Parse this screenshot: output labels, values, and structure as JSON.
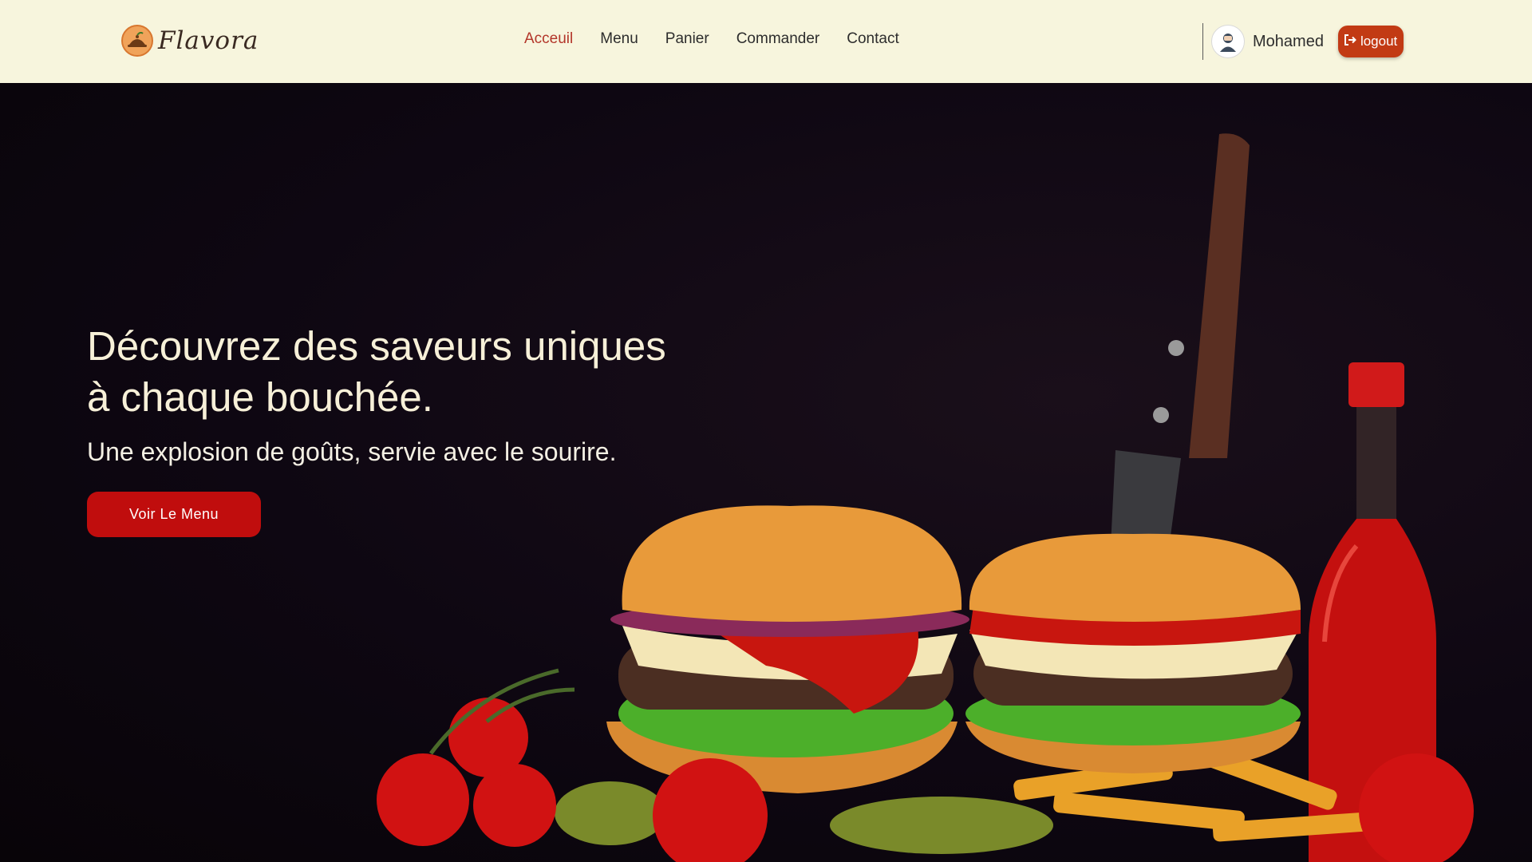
{
  "brand": {
    "name": "Flavora",
    "logo_icon": "cloche-icon"
  },
  "nav": {
    "links": [
      {
        "label": "Acceuil",
        "active": true
      },
      {
        "label": "Menu",
        "active": false
      },
      {
        "label": "Panier",
        "active": false
      },
      {
        "label": "Commander",
        "active": false
      },
      {
        "label": "Contact",
        "active": false
      }
    ]
  },
  "user": {
    "name": "Mohamed",
    "avatar_icon": "user-avatar-icon",
    "logout_label": "logout",
    "logout_icon": "logout-icon"
  },
  "hero": {
    "title_line1": "Découvrez des saveurs uniques",
    "title_line2": "à chaque bouchée.",
    "subtitle": "Une explosion de goûts, servie avec le sourire.",
    "cta_label": "Voir Le Menu"
  },
  "colors": {
    "navbar_bg": "#f7f5dd",
    "active_link": "#b3362a",
    "logout_bg": "#c23a14",
    "cta_bg": "#c00d0d",
    "hero_bg": "#0e0712"
  }
}
